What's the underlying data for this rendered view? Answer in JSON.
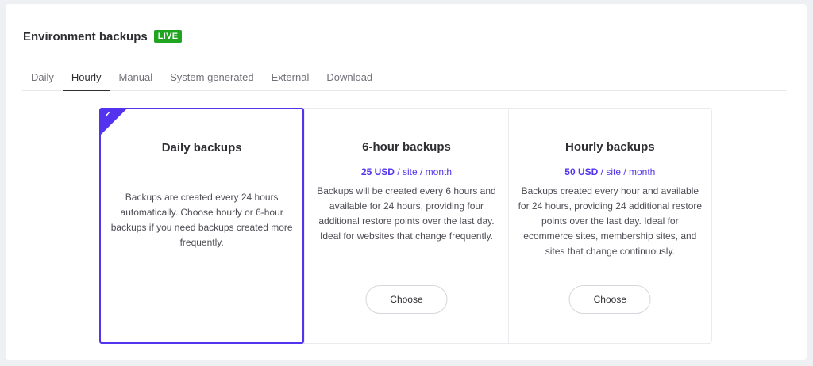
{
  "header": {
    "title": "Environment backups",
    "badge": "LIVE"
  },
  "tabs": [
    {
      "label": "Daily"
    },
    {
      "label": "Hourly"
    },
    {
      "label": "Manual"
    },
    {
      "label": "System generated"
    },
    {
      "label": "External"
    },
    {
      "label": "Download"
    }
  ],
  "active_tab": "Hourly",
  "cards": [
    {
      "title": "Daily backups",
      "selected": true,
      "description": "Backups are created every 24 hours automatically. Choose hourly or 6-hour backups if you need backups created more frequently."
    },
    {
      "title": "6-hour backups",
      "price": "25 USD",
      "price_unit": " / site / month",
      "description": "Backups will be created every 6 hours and available for 24 hours, providing four additional restore points over the last day. Ideal for websites that change frequently.",
      "button": "Choose"
    },
    {
      "title": "Hourly backups",
      "price": "50 USD",
      "price_unit": " / site / month",
      "description": "Backups created every hour and available for 24 hours, providing 24 additional restore points over the last day. Ideal for ecommerce sites, membership sites, and sites that change continuously.",
      "button": "Choose"
    }
  ],
  "colors": {
    "accent": "#5333ed",
    "live": "#1fa51f"
  },
  "icons": {
    "selected": "check-icon"
  }
}
